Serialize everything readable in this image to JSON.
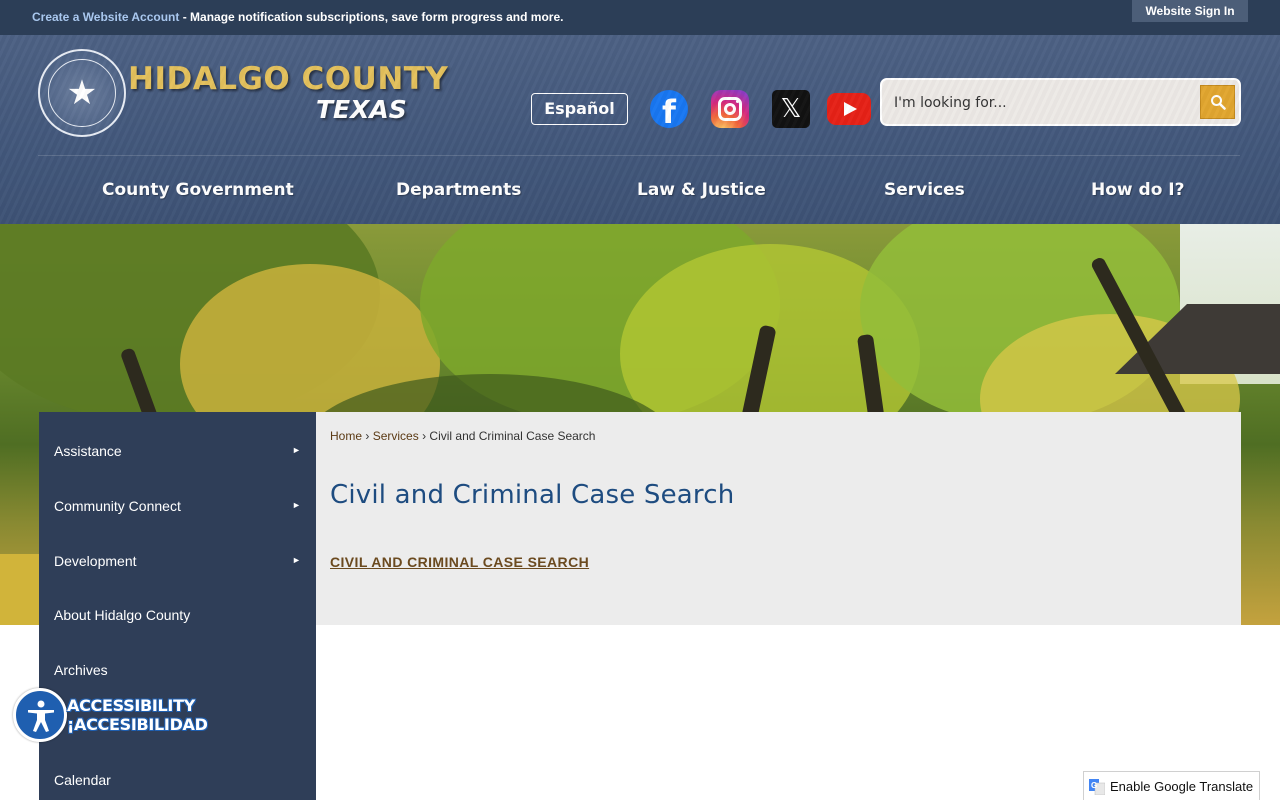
{
  "topbar": {
    "account_link": "Create a Website Account",
    "account_desc": " - Manage notification subscriptions, save form progress and more.",
    "signin": "Website Sign In"
  },
  "header": {
    "logo_title": "HIDALGO COUNTY",
    "logo_subtitle": "TEXAS",
    "espanol": "Español",
    "social": [
      "facebook-icon",
      "instagram-icon",
      "x-icon",
      "youtube-icon"
    ],
    "search_placeholder": "I'm looking for..."
  },
  "nav": [
    {
      "label": "County Government"
    },
    {
      "label": "Departments"
    },
    {
      "label": "Law & Justice"
    },
    {
      "label": "Services"
    },
    {
      "label": "How do I?"
    }
  ],
  "breadcrumb": {
    "home": "Home",
    "sep": "›",
    "services": "Services",
    "current": "Civil and Criminal Case Search"
  },
  "page": {
    "title": "Civil and Criminal Case Search",
    "link": "CIVIL AND CRIMINAL CASE SEARCH"
  },
  "sidebar": {
    "arrow": "►",
    "items": [
      {
        "label": "Assistance"
      },
      {
        "label": "Community Connect"
      },
      {
        "label": "Development"
      },
      {
        "label": "About Hidalgo County"
      },
      {
        "label": "Archives"
      },
      {
        "label": ""
      },
      {
        "label": "Calendar"
      }
    ]
  },
  "accessibility": {
    "line1": "ACCESSIBILITY",
    "line2": "¡ACCESIBILIDAD"
  },
  "translate": {
    "label": "Enable Google Translate"
  },
  "colors": {
    "topbar": "#2c3e57",
    "header": "#43587c",
    "gold": "#e3c15c",
    "title_blue": "#1e4c80",
    "link_brown": "#6b4a1f",
    "sidebar": "#2f3e58",
    "search_button": "#e1a62f"
  }
}
